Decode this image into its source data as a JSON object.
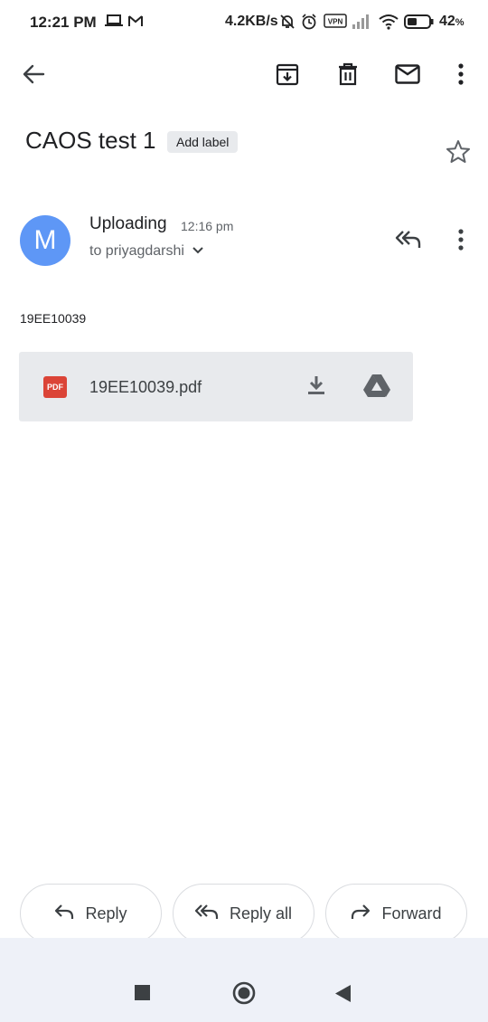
{
  "status_bar": {
    "time": "12:21 PM",
    "net_speed": "4.2KB/s",
    "battery_level": "42",
    "battery_unit": "%",
    "vpn_label": "VPN",
    "icons": [
      "laptop-icon",
      "gmail-icon",
      "mute-bell-icon",
      "alarm-icon",
      "vpn-icon",
      "signal-icon",
      "wifi-icon",
      "battery-icon"
    ]
  },
  "toolbar": {
    "icons": [
      "back-arrow-icon",
      "archive-icon",
      "delete-icon",
      "mark-unread-icon",
      "more-vert-icon"
    ]
  },
  "email": {
    "subject": "CAOS test 1",
    "add_label": "Add label",
    "sender": {
      "avatar_letter": "M",
      "avatar_color": "#5e97f6",
      "name": "Uploading",
      "time": "12:16 pm",
      "recipients": "to priyagdarshi"
    },
    "body": "19EE10039",
    "attachment": {
      "type_badge": "PDF",
      "filename": "19EE10039.pdf"
    }
  },
  "actions": {
    "reply": "Reply",
    "reply_all": "Reply all",
    "forward": "Forward"
  },
  "colors": {
    "accent_blue": "#5e97f6",
    "pdf_red": "#db4437",
    "chip_bg": "#e8eaed",
    "navbar_bg": "#eef1f8"
  }
}
